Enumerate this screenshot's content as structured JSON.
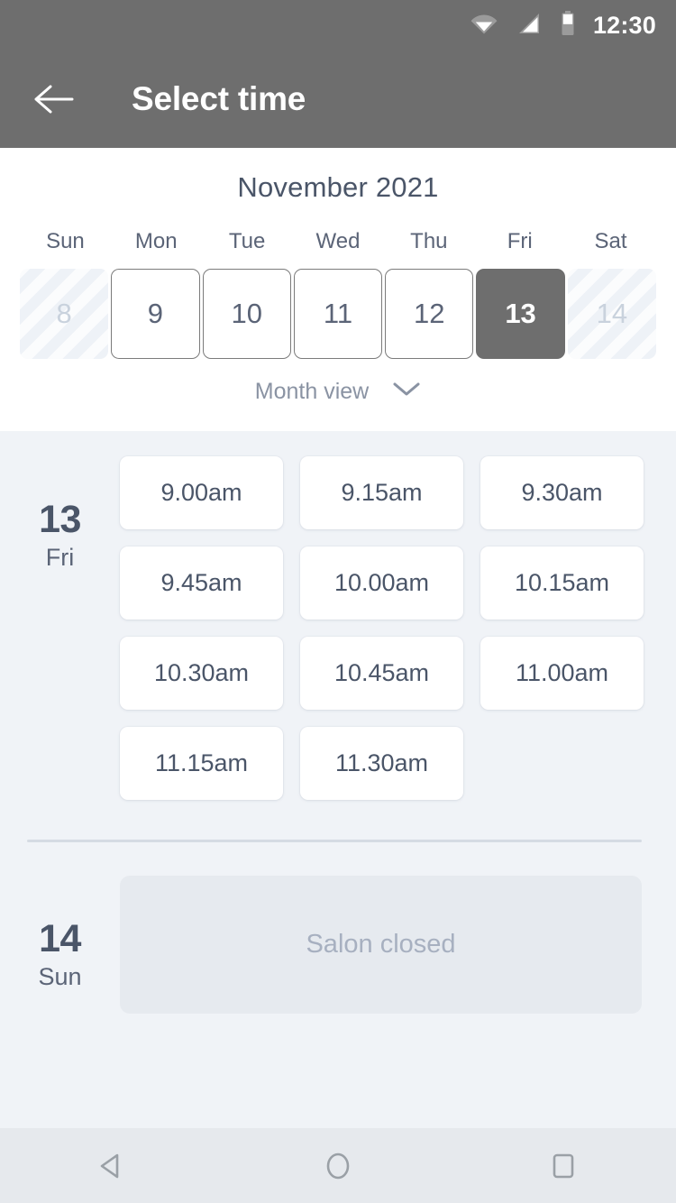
{
  "statusbar": {
    "time": "12:30",
    "icons": [
      "wifi-icon",
      "cellular-signal-icon",
      "battery-icon"
    ]
  },
  "appbar": {
    "back_icon": "arrow-left-icon",
    "title": "Select time",
    "background": "#6e6e6e"
  },
  "calendar": {
    "month_title": "November 2021",
    "weekdays": [
      "Sun",
      "Mon",
      "Tue",
      "Wed",
      "Thu",
      "Fri",
      "Sat"
    ],
    "days": [
      {
        "label": "8",
        "state": "disabled"
      },
      {
        "label": "9",
        "state": "available"
      },
      {
        "label": "10",
        "state": "available"
      },
      {
        "label": "11",
        "state": "available"
      },
      {
        "label": "12",
        "state": "available"
      },
      {
        "label": "13",
        "state": "selected"
      },
      {
        "label": "14",
        "state": "disabled"
      }
    ],
    "view_toggle": {
      "label": "Month view",
      "icon": "chevron-down-icon"
    },
    "selected_color": "#6e6e6e",
    "text_color": "#4a5568"
  },
  "schedule": [
    {
      "day_number": "13",
      "day_name": "Fri",
      "slots": [
        "9.00am",
        "9.15am",
        "9.30am",
        "9.45am",
        "10.00am",
        "10.15am",
        "10.30am",
        "10.45am",
        "11.00am",
        "11.15am",
        "11.30am"
      ],
      "closed_message": null
    },
    {
      "day_number": "14",
      "day_name": "Sun",
      "slots": [],
      "closed_message": "Salon closed"
    }
  ],
  "navbar": {
    "back": "triangle-back-icon",
    "home": "circle-home-icon",
    "recents": "square-recents-icon"
  }
}
